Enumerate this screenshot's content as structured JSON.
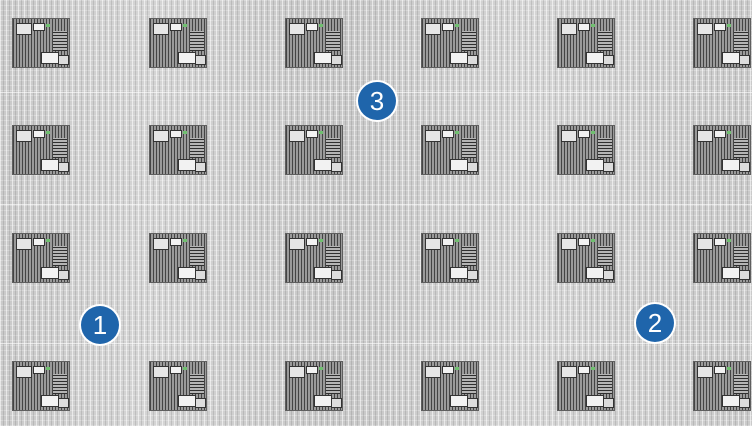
{
  "image": {
    "description_style": "tiled patterned surface with gray rectangular panels",
    "background_color": "#d2d2d2",
    "panel_color": "#8a8a8a"
  },
  "callouts": [
    {
      "label": "1",
      "color": "#1f65ab"
    },
    {
      "label": "2",
      "color": "#1f65ab"
    },
    {
      "label": "3",
      "color": "#1f65ab"
    }
  ]
}
